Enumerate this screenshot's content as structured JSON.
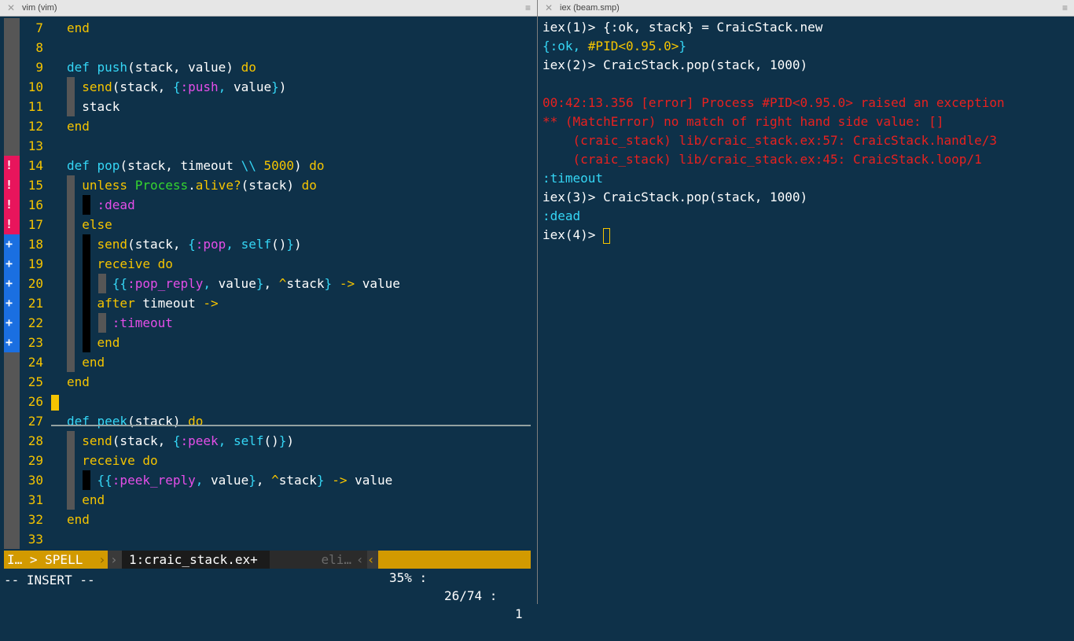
{
  "tabs": {
    "left_title": "vim (vim)",
    "right_title": "iex (beam.smp)",
    "close_glyph": "✕",
    "menu_glyph": "≡"
  },
  "editor": {
    "lines": [
      {
        "num": "7",
        "sign": "",
        "tokens": [
          [
            "k",
            "end"
          ]
        ]
      },
      {
        "num": "8",
        "sign": "",
        "tokens": []
      },
      {
        "num": "9",
        "sign": "",
        "tokens": [
          [
            "f",
            "def "
          ],
          [
            "f",
            "push"
          ],
          [
            "w",
            "(stack, value) "
          ],
          [
            "k",
            "do"
          ]
        ]
      },
      {
        "num": "10",
        "sign": "",
        "tokens": [
          [
            "w",
            "  "
          ],
          [
            "k",
            "send"
          ],
          [
            "w",
            "(stack, "
          ],
          [
            "f",
            "{"
          ],
          [
            "a",
            ":push"
          ],
          [
            "f",
            ", "
          ],
          [
            "w",
            "value"
          ],
          [
            "f",
            "}"
          ],
          [
            "w",
            ")"
          ]
        ]
      },
      {
        "num": "11",
        "sign": "",
        "tokens": [
          [
            "w",
            "  stack"
          ]
        ]
      },
      {
        "num": "12",
        "sign": "",
        "tokens": [
          [
            "k",
            "end"
          ]
        ]
      },
      {
        "num": "13",
        "sign": "",
        "tokens": []
      },
      {
        "num": "14",
        "sign": "!",
        "tokens": [
          [
            "f",
            "def "
          ],
          [
            "f",
            "pop"
          ],
          [
            "w",
            "(stack, timeout "
          ],
          [
            "f",
            "\\\\"
          ],
          [
            "w",
            " "
          ],
          [
            "n",
            "5000"
          ],
          [
            "w",
            ") "
          ],
          [
            "k",
            "do"
          ]
        ]
      },
      {
        "num": "15",
        "sign": "!",
        "tokens": [
          [
            "w",
            "  "
          ],
          [
            "k",
            "unless "
          ],
          [
            "m",
            "Process"
          ],
          [
            "w",
            "."
          ],
          [
            "k",
            "alive?"
          ],
          [
            "w",
            "(stack) "
          ],
          [
            "k",
            "do"
          ]
        ]
      },
      {
        "num": "16",
        "sign": "!",
        "tokens": [
          [
            "w",
            "    "
          ],
          [
            "a",
            ":dead"
          ]
        ]
      },
      {
        "num": "17",
        "sign": "!",
        "tokens": [
          [
            "w",
            "  "
          ],
          [
            "k",
            "else"
          ]
        ]
      },
      {
        "num": "18",
        "sign": "+",
        "tokens": [
          [
            "w",
            "    "
          ],
          [
            "k",
            "send"
          ],
          [
            "w",
            "(stack, "
          ],
          [
            "f",
            "{"
          ],
          [
            "a",
            ":pop"
          ],
          [
            "f",
            ", "
          ],
          [
            "f",
            "self"
          ],
          [
            "w",
            "()"
          ],
          [
            "f",
            "}"
          ],
          [
            "w",
            ")"
          ]
        ]
      },
      {
        "num": "19",
        "sign": "+",
        "tokens": [
          [
            "w",
            "    "
          ],
          [
            "k",
            "receive do"
          ]
        ]
      },
      {
        "num": "20",
        "sign": "+",
        "tokens": [
          [
            "w",
            "      "
          ],
          [
            "f",
            "{{"
          ],
          [
            "a",
            ":pop_reply"
          ],
          [
            "f",
            ", "
          ],
          [
            "w",
            "value"
          ],
          [
            "f",
            "}"
          ],
          [
            "w",
            ", "
          ],
          [
            "k",
            "^"
          ],
          [
            "w",
            "stack"
          ],
          [
            "f",
            "}"
          ],
          [
            "w",
            " "
          ],
          [
            "k",
            "->"
          ],
          [
            "w",
            " value"
          ]
        ]
      },
      {
        "num": "21",
        "sign": "+",
        "tokens": [
          [
            "w",
            "    "
          ],
          [
            "k",
            "after "
          ],
          [
            "w",
            "timeout "
          ],
          [
            "k",
            "->"
          ]
        ]
      },
      {
        "num": "22",
        "sign": "+",
        "tokens": [
          [
            "w",
            "      "
          ],
          [
            "a",
            ":timeout"
          ]
        ]
      },
      {
        "num": "23",
        "sign": "+",
        "tokens": [
          [
            "w",
            "    "
          ],
          [
            "k",
            "end"
          ]
        ]
      },
      {
        "num": "24",
        "sign": "",
        "tokens": [
          [
            "w",
            "  "
          ],
          [
            "k",
            "end"
          ]
        ]
      },
      {
        "num": "25",
        "sign": "",
        "tokens": [
          [
            "k",
            "end"
          ]
        ]
      },
      {
        "num": "26",
        "sign": "",
        "tokens": []
      },
      {
        "num": "27",
        "sign": "",
        "tokens": [
          [
            "f",
            "def "
          ],
          [
            "f",
            "peek"
          ],
          [
            "w",
            "(stack) "
          ],
          [
            "k",
            "do"
          ]
        ]
      },
      {
        "num": "28",
        "sign": "",
        "tokens": [
          [
            "w",
            "  "
          ],
          [
            "k",
            "send"
          ],
          [
            "w",
            "(stack, "
          ],
          [
            "f",
            "{"
          ],
          [
            "a",
            ":peek"
          ],
          [
            "f",
            ", "
          ],
          [
            "f",
            "self"
          ],
          [
            "w",
            "()"
          ],
          [
            "f",
            "}"
          ],
          [
            "w",
            ")"
          ]
        ]
      },
      {
        "num": "29",
        "sign": "",
        "tokens": [
          [
            "w",
            "  "
          ],
          [
            "k",
            "receive do"
          ]
        ]
      },
      {
        "num": "30",
        "sign": "",
        "tokens": [
          [
            "w",
            "    "
          ],
          [
            "f",
            "{{"
          ],
          [
            "a",
            ":peek_reply"
          ],
          [
            "f",
            ", "
          ],
          [
            "w",
            "value"
          ],
          [
            "f",
            "}"
          ],
          [
            "w",
            ", "
          ],
          [
            "k",
            "^"
          ],
          [
            "w",
            "stack"
          ],
          [
            "f",
            "}"
          ],
          [
            "w",
            " "
          ],
          [
            "k",
            "->"
          ],
          [
            "w",
            " value"
          ]
        ]
      },
      {
        "num": "31",
        "sign": "",
        "tokens": [
          [
            "w",
            "  "
          ],
          [
            "k",
            "end"
          ]
        ]
      },
      {
        "num": "32",
        "sign": "",
        "tokens": [
          [
            "k",
            "end"
          ]
        ]
      },
      {
        "num": "33",
        "sign": "",
        "tokens": []
      }
    ],
    "statusline": {
      "mode": "I… > SPELL",
      "sep1": "›",
      "sep2": "›",
      "filename": "1:craic_stack.ex+",
      "filetype": "eli…",
      "sep3": "‹",
      "sep4": "‹",
      "percent": "35% :",
      "position": "26/74 :",
      "column": "1"
    },
    "command_line": "-- INSERT --"
  },
  "terminal": {
    "lines": [
      [
        [
          "w",
          "iex(1)> {:ok, stack} = CraicStack.new"
        ]
      ],
      [
        [
          "cy",
          "{:ok, "
        ],
        [
          "yl",
          "#PID<0.95.0>"
        ],
        [
          "cy",
          "}"
        ]
      ],
      [
        [
          "w",
          "iex(2)> CraicStack.pop(stack, 1000)"
        ]
      ],
      [],
      [
        [
          "err",
          "00:42:13.356 [error] Process #PID<0.95.0> raised an exception"
        ]
      ],
      [
        [
          "err",
          "** (MatchError) no match of right hand side value: []"
        ]
      ],
      [
        [
          "err",
          "    (craic_stack) lib/craic_stack.ex:57: CraicStack.handle/3"
        ]
      ],
      [
        [
          "err",
          "    (craic_stack) lib/craic_stack.ex:45: CraicStack.loop/1"
        ]
      ],
      [
        [
          "cy",
          ":timeout"
        ]
      ],
      [
        [
          "w",
          "iex(3)> CraicStack.pop(stack, 1000)"
        ]
      ],
      [
        [
          "cy",
          ":dead"
        ]
      ],
      [
        [
          "w",
          "iex(4)> "
        ]
      ]
    ]
  }
}
